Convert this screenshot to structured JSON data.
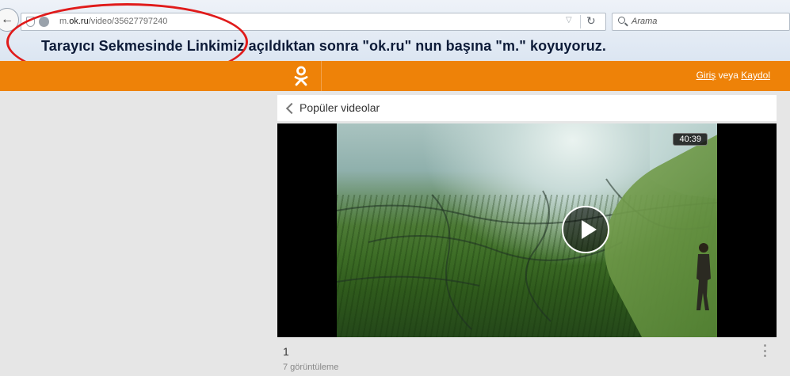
{
  "browser": {
    "url_prefix": "m.",
    "url_domain": "ok.ru",
    "url_path": "/video/35627797240",
    "search_placeholder": "Arama",
    "back_icon": "back-arrow-icon",
    "reload_icon": "reload-icon"
  },
  "annotation": {
    "text": "Tarayıcı Sekmesinde Linkimiz açıldıktan sonra \"ok.ru\" nun başına \"m.\" koyuyoruz.",
    "ellipse_color": "#e01b1b"
  },
  "site_header": {
    "brand_color": "#ee8208",
    "login_label": "Giriş",
    "or_label": "veya",
    "signup_label": "Kaydol"
  },
  "card": {
    "back_title": "Popüler videolar"
  },
  "video": {
    "duration": "40:39",
    "title": "1",
    "views": "7 görüntüleme"
  }
}
